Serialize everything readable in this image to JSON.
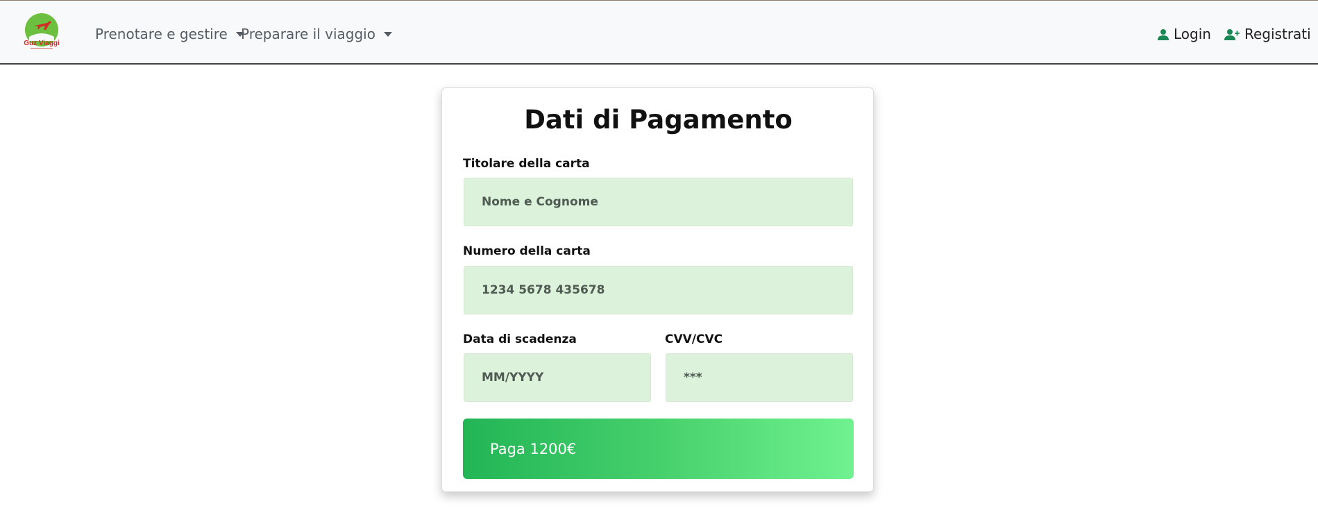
{
  "navbar": {
    "logo_text": "Guz Viaggi",
    "menus": [
      {
        "label": "Prenotare e gestire"
      },
      {
        "label": "Preparare il viaggio"
      }
    ],
    "login_label": "Login",
    "register_label": "Registrati"
  },
  "payment_form": {
    "title": "Dati di Pagamento",
    "cardholder_label": "Titolare della carta",
    "cardholder_placeholder": "Nome e Cognome",
    "card_number_label": "Numero della carta",
    "card_number_placeholder": "1234 5678 435678",
    "expiry_label": "Data di scadenza",
    "expiry_placeholder": "MM/YYYY",
    "cvv_label": "CVV/CVC",
    "cvv_placeholder": "***",
    "pay_button_label": "Paga 1200€"
  },
  "colors": {
    "navbar_bg": "#f8f9fa",
    "field_bg": "#dcf2da",
    "accent_green": "#22b556",
    "icon_green": "#198754"
  },
  "icons": {
    "login": "user-icon",
    "register": "user-plus-icon",
    "logo": "airplane-logo"
  }
}
